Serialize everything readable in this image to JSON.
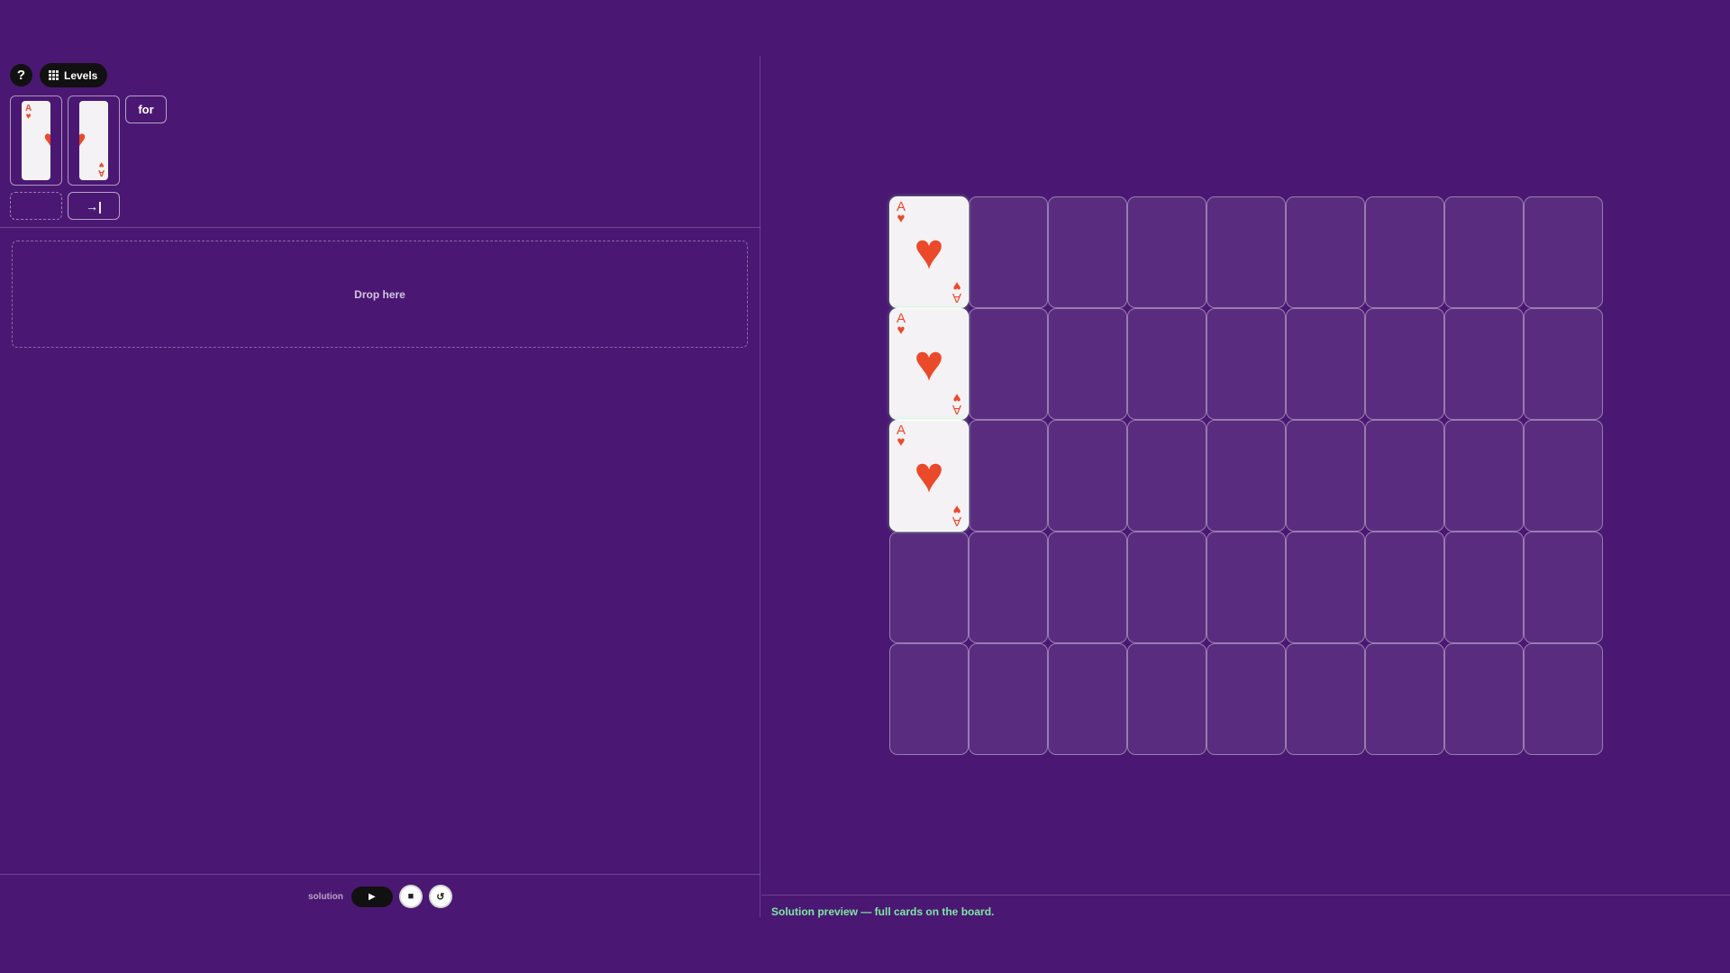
{
  "toolbar": {
    "help_label": "?",
    "levels_label": "Levels"
  },
  "palette": {
    "cards": [
      {
        "rank": "A",
        "suit": "♥",
        "half": "left"
      },
      {
        "rank": "A",
        "suit": "♥",
        "half": "right"
      }
    ],
    "for_label": "for",
    "indent_icon": "→|"
  },
  "program": {
    "drop_placeholder": "Drop here"
  },
  "controls": {
    "label": "solution",
    "play_icon": "▶",
    "stop_icon": "■",
    "reset_icon": "↺"
  },
  "board": {
    "columns": 9,
    "rows": 5,
    "cards": [
      {
        "row": 0,
        "col": 0,
        "rank": "A",
        "suit": "♥"
      },
      {
        "row": 1,
        "col": 0,
        "rank": "A",
        "suit": "♥"
      },
      {
        "row": 2,
        "col": 0,
        "rank": "A",
        "suit": "♥"
      }
    ]
  },
  "status": {
    "message": "Solution preview — full cards on the board."
  },
  "colors": {
    "background": "#4a1873",
    "heart": "#ea4a2a",
    "status_text": "#7ee8a2"
  }
}
